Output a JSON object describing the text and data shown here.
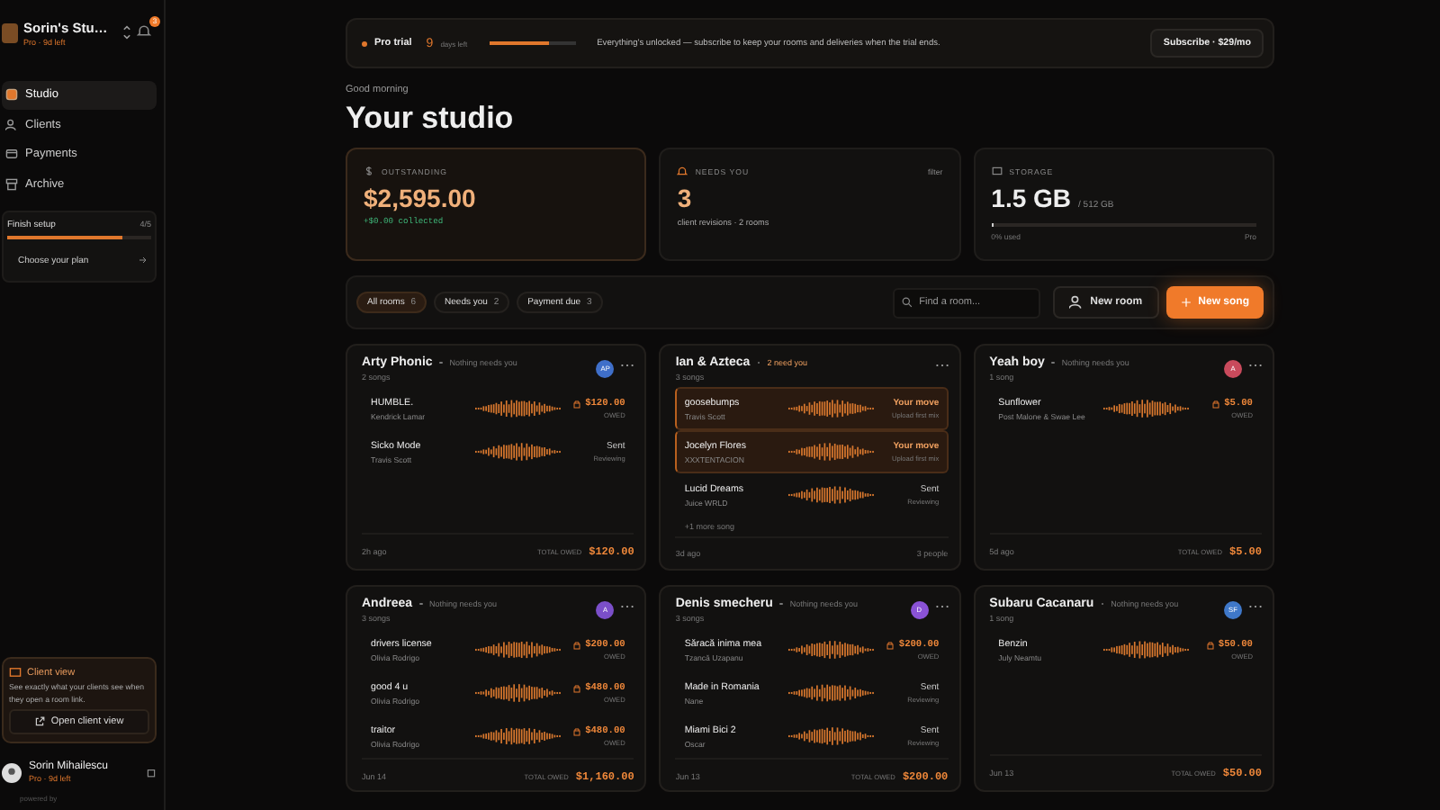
{
  "sidebar": {
    "workspace": "Sorin's Stu…",
    "plan": "Pro · 9d left",
    "notifications": "3",
    "nav": [
      {
        "label": "Studio",
        "selected": true
      },
      {
        "label": "Clients",
        "selected": false
      },
      {
        "label": "Payments",
        "selected": false
      },
      {
        "label": "Archive",
        "selected": false
      }
    ],
    "setup": {
      "title": "Finish setup",
      "count": "4/5",
      "level": 0.8,
      "next": "Choose your plan"
    },
    "client_view": {
      "title": "Client view",
      "text": "See exactly what your clients see when they open a room link.",
      "button": "Open client view"
    },
    "user": {
      "name": "Sorin Mihailescu",
      "plan": "Pro · 9d left"
    },
    "powered": "powered by"
  },
  "banner": {
    "badge": "Pro trial",
    "days": "9",
    "days_label": "days left",
    "level": 0.7,
    "text": "Everything's unlocked — subscribe to keep your rooms and deliveries when the trial ends.",
    "button": "Subscribe · $29/mo"
  },
  "greeting": "Good morning",
  "title": "Your studio",
  "stats": [
    {
      "kind": "money",
      "label": "OUTSTANDING",
      "value": "$2,595.00",
      "note": "+$0.00 collected"
    },
    {
      "kind": "alert",
      "label": "NEEDS YOU",
      "value": "3",
      "note": "client revisions · 2 rooms",
      "link": "filter"
    },
    {
      "kind": "storage",
      "label": "STORAGE",
      "value": "1.5 GB",
      "unit": "/ 512 GB",
      "level": 0.003,
      "used": "0% used",
      "plan": "Pro"
    }
  ],
  "filters": [
    {
      "label": "All rooms",
      "count": "6",
      "selected": true
    },
    {
      "label": "Needs you",
      "count": "2",
      "selected": false
    },
    {
      "label": "Payment due",
      "count": "3",
      "selected": false
    }
  ],
  "search": {
    "placeholder": "Find a room..."
  },
  "actions": {
    "new_room": "New room",
    "new_song": "New song"
  },
  "rooms": [
    {
      "name": "Arty Phonic",
      "status": "Nothing needs you",
      "alert": false,
      "songs_count": "2 songs",
      "avatar": {
        "initials": "AP",
        "color": "#3f6fc9"
      },
      "songs": [
        {
          "title": "HUMBLE.",
          "artist": "Kendrick Lamar",
          "kind": "owed",
          "status": "$120.00",
          "note": "OWED"
        },
        {
          "title": "Sicko Mode",
          "artist": "Travis Scott",
          "kind": "sent",
          "status": "Sent",
          "note": "Reviewing"
        }
      ],
      "footer": {
        "time": "2h ago",
        "label": "TOTAL OWED",
        "value": "$120.00"
      }
    },
    {
      "name": "Ian & Azteca",
      "status": "2 need you",
      "alert": true,
      "songs_count": "3 songs",
      "songs": [
        {
          "title": "goosebumps",
          "artist": "Travis Scott",
          "kind": "move",
          "status": "Your move",
          "note": "Upload first mix"
        },
        {
          "title": "Jocelyn Flores",
          "artist": "XXXTENTACION",
          "kind": "move",
          "status": "Your move",
          "note": "Upload first mix"
        },
        {
          "title": "Lucid Dreams",
          "artist": "Juice WRLD",
          "kind": "sent",
          "status": "Sent",
          "note": "Reviewing"
        }
      ],
      "more": "+1 more song",
      "footer": {
        "time": "3d ago",
        "value": "3 people"
      }
    },
    {
      "name": "Yeah boy",
      "status": "Nothing needs you",
      "alert": false,
      "songs_count": "1 song",
      "avatar": {
        "initials": "A",
        "color": "#c94a5c"
      },
      "songs": [
        {
          "title": "Sunflower",
          "artist": "Post Malone & Swae Lee",
          "kind": "owed",
          "status": "$5.00",
          "note": "OWED"
        }
      ],
      "footer": {
        "time": "5d ago",
        "label": "TOTAL OWED",
        "value": "$5.00"
      }
    },
    {
      "name": "Andreea",
      "status": "Nothing needs you",
      "alert": false,
      "songs_count": "3 songs",
      "avatar": {
        "initials": "A",
        "color": "#7b4fc9"
      },
      "songs": [
        {
          "title": "drivers license",
          "artist": "Olivia Rodrigo",
          "kind": "owed",
          "status": "$200.00",
          "note": "OWED"
        },
        {
          "title": "good 4 u",
          "artist": "Olivia Rodrigo",
          "kind": "owed",
          "status": "$480.00",
          "note": "OWED"
        },
        {
          "title": "traitor",
          "artist": "Olivia Rodrigo",
          "kind": "owed",
          "status": "$480.00",
          "note": "OWED"
        }
      ],
      "footer": {
        "time": "Jun 14",
        "label": "TOTAL OWED",
        "value": "$1,160.00"
      }
    },
    {
      "name": "Denis smecheru",
      "status": "Nothing needs you",
      "alert": false,
      "songs_count": "3 songs",
      "avatar": {
        "initials": "D",
        "color": "#8a52d6"
      },
      "songs": [
        {
          "title": "Săracă inima mea",
          "artist": "Tzancă Uzapanu",
          "kind": "owed",
          "status": "$200.00",
          "note": "OWED"
        },
        {
          "title": "Made in Romania",
          "artist": "Nane",
          "kind": "sent",
          "status": "Sent",
          "note": "Reviewing"
        },
        {
          "title": "Miami Bici 2",
          "artist": "Oscar",
          "kind": "sent",
          "status": "Sent",
          "note": "Reviewing"
        }
      ],
      "footer": {
        "time": "Jun 13",
        "label": "TOTAL OWED",
        "value": "$200.00"
      }
    },
    {
      "name": "Subaru Cacanaru",
      "status": "Nothing needs you",
      "alert": false,
      "songs_count": "1 song",
      "avatar": {
        "initials": "SF",
        "color": "#3f78c9"
      },
      "songs": [
        {
          "title": "Benzin",
          "artist": "July Neamtu",
          "kind": "owed",
          "status": "$50.00",
          "note": "OWED"
        }
      ],
      "footer": {
        "time": "Jun 13",
        "label": "TOTAL OWED",
        "value": "$50.00"
      }
    }
  ]
}
